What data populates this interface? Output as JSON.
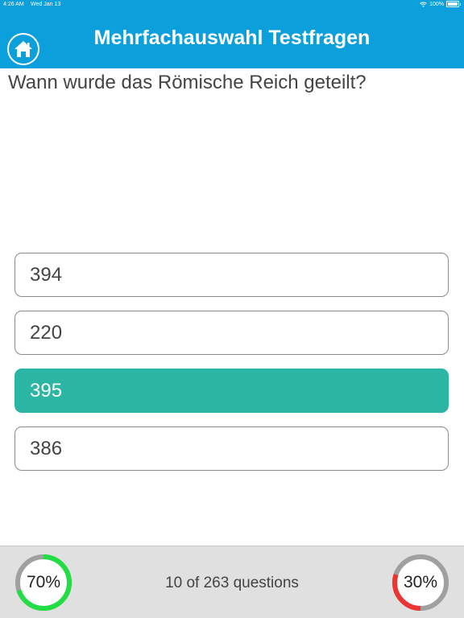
{
  "status": {
    "time": "4:26 AM",
    "date": "Wed Jan 13",
    "battery": "100%"
  },
  "header": {
    "title": "Mehrfachauswahl Testfragen"
  },
  "question": {
    "text": "Wann wurde das Römische Reich geteilt?"
  },
  "answers": [
    {
      "label": "394",
      "selected": false
    },
    {
      "label": "220",
      "selected": false
    },
    {
      "label": "395",
      "selected": true
    },
    {
      "label": "386",
      "selected": false
    }
  ],
  "footer": {
    "correct_percent_label": "70%",
    "correct_fraction": 0.7,
    "wrong_percent_label": "30%",
    "wrong_fraction": 0.3,
    "progress_text": "10 of 263 questions"
  },
  "colors": {
    "header": "#0b9fdc",
    "selected_answer": "#2bb5a3",
    "correct": "#22dd44",
    "wrong": "#ee3333",
    "gauge_track": "#a0a0a0"
  }
}
